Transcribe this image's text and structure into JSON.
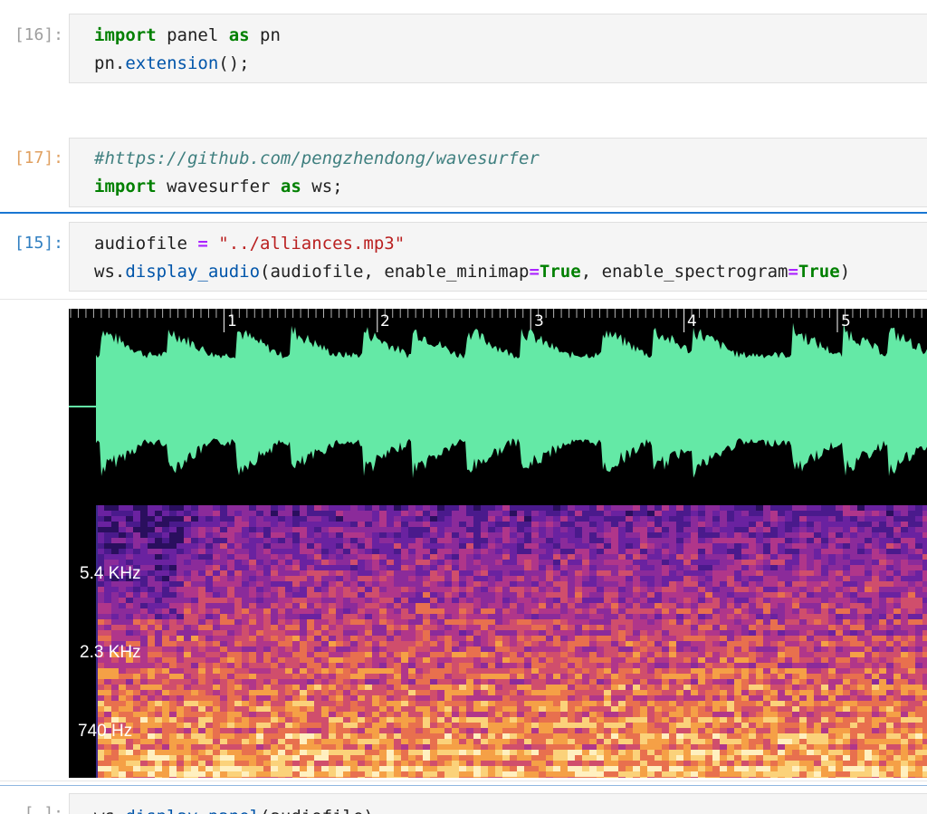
{
  "cells": {
    "c16": {
      "prompt": "[16]:",
      "line1": {
        "k1": "import",
        "t1": " panel ",
        "k2": "as",
        "t2": " pn"
      },
      "line2": {
        "o": "pn.",
        "f": "extension",
        "t": "();"
      }
    },
    "c17": {
      "prompt": "[17]:",
      "comment": "#https://github.com/pengzhendong/wavesurfer",
      "line2": {
        "k1": "import",
        "t1": " wavesurfer ",
        "k2": "as",
        "t2": " ws;"
      }
    },
    "c15": {
      "prompt": "[15]:",
      "line1": {
        "a": "audiofile ",
        "op": "=",
        "s": " \"../alliances.mp3\""
      },
      "line2": {
        "a": "ws.",
        "f": "display_audio",
        "b": "(audiofile, enable_minimap",
        "op1": "=",
        "t1": "True",
        "c": ", enable_spectrogram",
        "op2": "=",
        "t2": "True",
        "d": ")"
      }
    },
    "c_next": {
      "prompt": "[ ]:",
      "line1": {
        "a": "ws.",
        "f": "display_panel",
        "b": "(audiofile)"
      }
    }
  },
  "player": {
    "timeline": [
      "1",
      "2",
      "3",
      "4",
      "5"
    ],
    "freq_labels": [
      "5.4 KHz",
      "2.3 KHz",
      "740  Hz"
    ],
    "wave_color": "#64e9a6",
    "background": "#000000"
  }
}
